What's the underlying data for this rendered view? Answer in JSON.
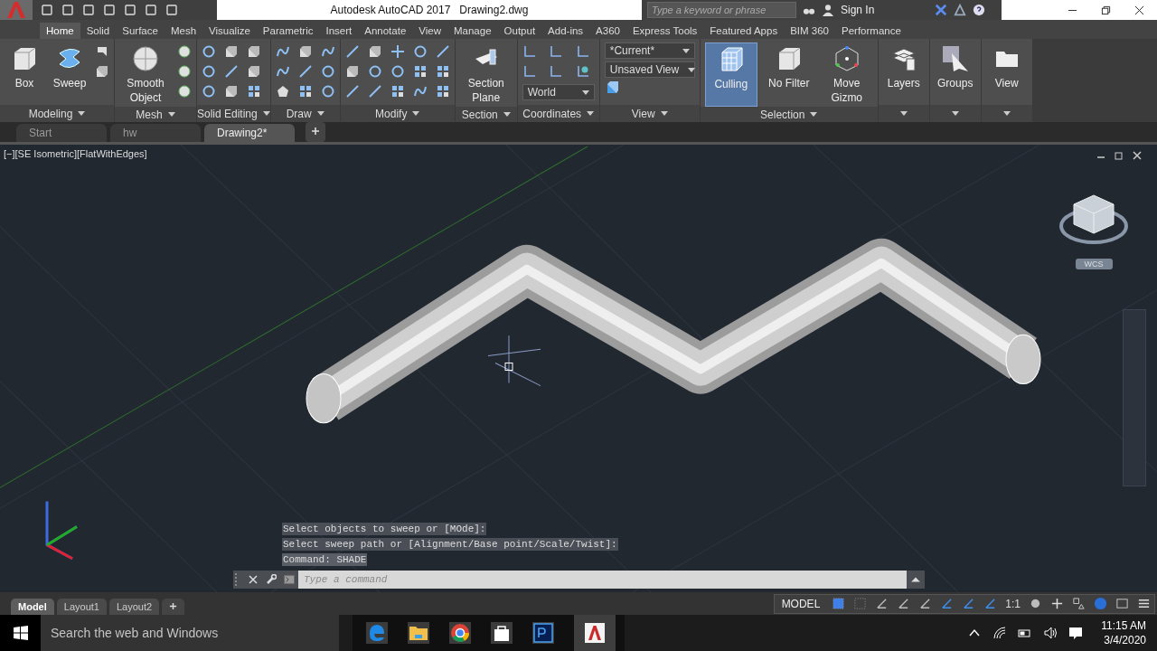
{
  "title_bar": {
    "app_title": "Autodesk AutoCAD 2017",
    "file_name": "Drawing2.dwg",
    "search_placeholder": "Type a keyword or phrase",
    "sign_in": "Sign In"
  },
  "ribbon_tabs": [
    {
      "label": "Home",
      "selected": true
    },
    {
      "label": "Solid",
      "selected": false
    },
    {
      "label": "Surface",
      "selected": false
    },
    {
      "label": "Mesh",
      "selected": false
    },
    {
      "label": "Visualize",
      "selected": false
    },
    {
      "label": "Parametric",
      "selected": false
    },
    {
      "label": "Insert",
      "selected": false
    },
    {
      "label": "Annotate",
      "selected": false
    },
    {
      "label": "View",
      "selected": false
    },
    {
      "label": "Manage",
      "selected": false
    },
    {
      "label": "Output",
      "selected": false
    },
    {
      "label": "Add-ins",
      "selected": false
    },
    {
      "label": "A360",
      "selected": false
    },
    {
      "label": "Express Tools",
      "selected": false
    },
    {
      "label": "Featured Apps",
      "selected": false
    },
    {
      "label": "BIM 360",
      "selected": false
    },
    {
      "label": "Performance",
      "selected": false
    }
  ],
  "panels": [
    {
      "kind": "modeling",
      "title": "Modeling",
      "large_buttons": [
        {
          "label": "Box",
          "on": false
        },
        {
          "label": "Sweep",
          "on": false
        }
      ]
    },
    {
      "kind": "mesh",
      "title": "Mesh",
      "large_buttons": [
        {
          "label": "Smooth Object",
          "on": false
        }
      ]
    },
    {
      "kind": "solid_editing",
      "title": "Solid Editing"
    },
    {
      "kind": "draw",
      "title": "Draw"
    },
    {
      "kind": "modify",
      "title": "Modify"
    },
    {
      "kind": "section",
      "title": "Section",
      "large_buttons": [
        {
          "label": "Section Plane",
          "on": false
        }
      ]
    },
    {
      "kind": "coordinates",
      "title": "Coordinates",
      "dropdowns": [
        "World"
      ]
    },
    {
      "kind": "view",
      "title": "View",
      "dropdowns": [
        "*Current*",
        "Unsaved View"
      ]
    },
    {
      "kind": "selection",
      "title": "Selection",
      "large_buttons": [
        {
          "label": "Culling",
          "on": true
        },
        {
          "label": "No Filter",
          "on": false
        },
        {
          "label": "Move Gizmo",
          "on": false
        }
      ]
    },
    {
      "kind": "layers",
      "large_buttons": [
        {
          "label": "Layers",
          "on": false
        }
      ]
    },
    {
      "kind": "groups",
      "large_buttons": [
        {
          "label": "Groups",
          "on": false
        }
      ]
    },
    {
      "kind": "viewbtn",
      "large_buttons": [
        {
          "label": "View",
          "on": false
        }
      ]
    }
  ],
  "file_tabs": [
    {
      "label": "Start",
      "selected": false
    },
    {
      "label": "hw",
      "selected": false
    },
    {
      "label": "Drawing2*",
      "selected": true
    }
  ],
  "viewport": {
    "label": "[−][SE Isometric][FlatWithEdges]",
    "ucs_label": "WCS",
    "command_history": [
      "Select objects to sweep or [MOde]:",
      "Select sweep path or [Alignment/Base point/Scale/Twist]:",
      "Command: SHADE"
    ],
    "command_placeholder": "Type a command"
  },
  "layout_tabs": [
    {
      "label": "Model",
      "selected": true
    },
    {
      "label": "Layout1",
      "selected": false
    },
    {
      "label": "Layout2",
      "selected": false
    }
  ],
  "status_bar": {
    "model_button": "MODEL",
    "scale": "1:1"
  },
  "taskbar": {
    "search_placeholder": "Search the web and Windows",
    "time": "11:15 AM",
    "date": "3/4/2020"
  }
}
